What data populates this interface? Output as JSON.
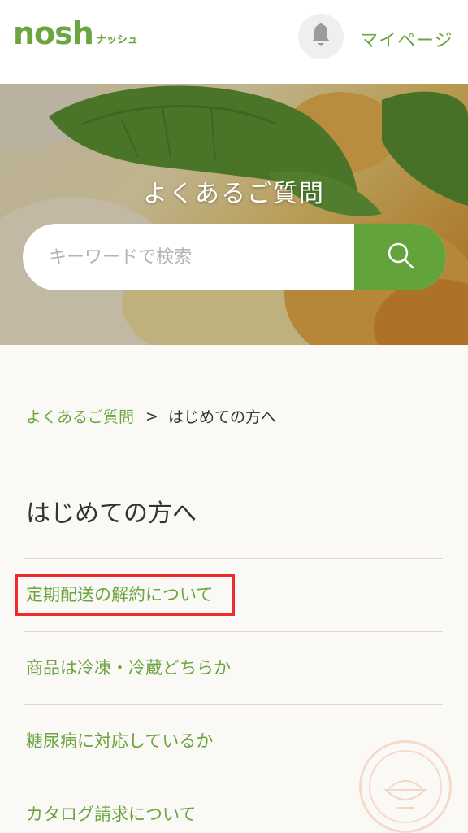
{
  "header": {
    "logo_main": "nosh",
    "logo_sub": "ナッシュ",
    "mypage_label": "マイページ"
  },
  "hero": {
    "title": "よくあるご質問",
    "search_placeholder": "キーワードで検索"
  },
  "breadcrumb": {
    "link": "よくあるご質問",
    "separator": ">",
    "current": "はじめての方へ"
  },
  "page_title": "はじめての方へ",
  "faq_items": [
    {
      "label": "定期配送の解約について"
    },
    {
      "label": "商品は冷凍・冷蔵どちらか"
    },
    {
      "label": "糖尿病に対応しているか"
    },
    {
      "label": "カタログ請求について"
    }
  ],
  "colors": {
    "brand_green": "#6aa53f",
    "search_button": "#62a43a",
    "highlight_red": "#ee2a2e"
  },
  "icons": {
    "bell": "bell-icon",
    "search": "search-icon"
  }
}
